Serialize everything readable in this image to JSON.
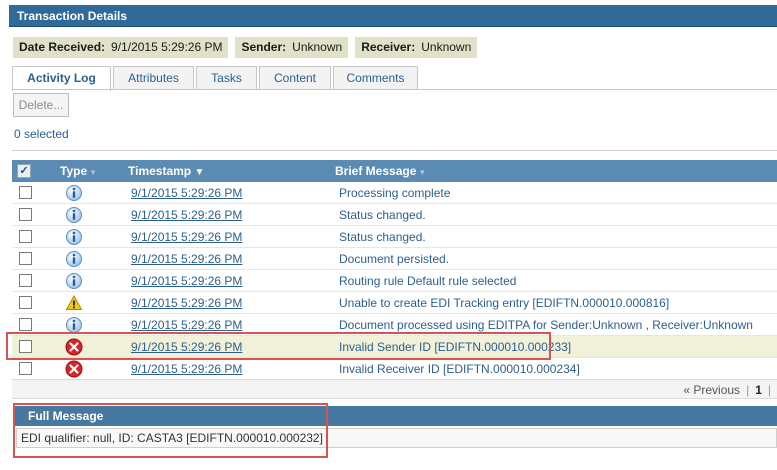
{
  "panel": {
    "title": "Transaction Details"
  },
  "meta": {
    "date_received_label": "Date Received:",
    "date_received_value": "9/1/2015 5:29:26 PM",
    "sender_label": "Sender:",
    "sender_value": "Unknown",
    "receiver_label": "Receiver:",
    "receiver_value": "Unknown"
  },
  "tabs": [
    {
      "label": "Activity Log",
      "active": true
    },
    {
      "label": "Attributes"
    },
    {
      "label": "Tasks"
    },
    {
      "label": "Content"
    },
    {
      "label": "Comments"
    }
  ],
  "toolbar": {
    "delete_label": "Delete..."
  },
  "selection": {
    "count_text": "0 selected"
  },
  "grid": {
    "columns": {
      "type": "Type",
      "timestamp": "Timestamp",
      "message": "Brief Message"
    },
    "rows": [
      {
        "icon": "info-icon",
        "timestamp": "9/1/2015 5:29:26 PM",
        "message": "Processing complete"
      },
      {
        "icon": "info-icon",
        "timestamp": "9/1/2015 5:29:26 PM",
        "message": "Status changed."
      },
      {
        "icon": "info-icon",
        "timestamp": "9/1/2015 5:29:26 PM",
        "message": "Status changed."
      },
      {
        "icon": "info-icon",
        "timestamp": "9/1/2015 5:29:26 PM",
        "message": "Document persisted."
      },
      {
        "icon": "info-icon",
        "timestamp": "9/1/2015 5:29:26 PM",
        "message": "Routing rule Default rule selected"
      },
      {
        "icon": "warning-icon",
        "timestamp": "9/1/2015 5:29:26 PM",
        "message": "Unable to create EDI Tracking entry  [EDIFTN.000010.000816]"
      },
      {
        "icon": "info-icon",
        "timestamp": "9/1/2015 5:29:26 PM",
        "message": "Document processed using EDITPA for Sender:Unknown , Receiver:Unknown"
      },
      {
        "icon": "error-icon",
        "timestamp": "9/1/2015 5:29:26 PM",
        "message": "Invalid Sender ID [EDIFTN.000010.000233]",
        "selected": true
      },
      {
        "icon": "error-icon",
        "timestamp": "9/1/2015 5:29:26 PM",
        "message": "Invalid Receiver ID [EDIFTN.000010.000234]"
      }
    ]
  },
  "pager": {
    "previous_label": "« Previous",
    "current_page": "1"
  },
  "full_message": {
    "title": "Full Message",
    "text": "EDI qualifier: null, ID: CASTA3 [EDIFTN.000010.000232]"
  },
  "colors": {
    "header": "#2f6a99",
    "grid_header": "#5b8bb3",
    "link": "#2c5f8d",
    "highlight_row": "#f1f1d9",
    "annotation": "#d9534f"
  }
}
